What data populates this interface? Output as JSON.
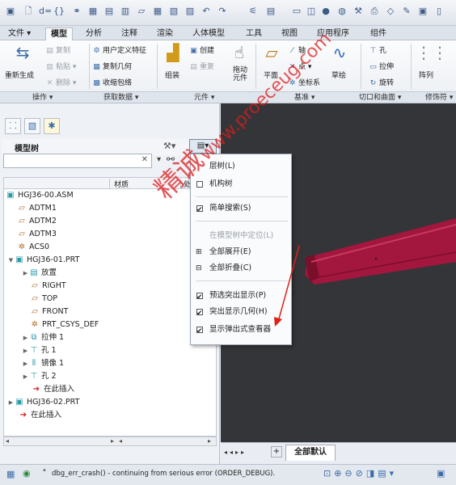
{
  "ribbon_tabs": [
    {
      "label": "文件 ▾",
      "active": false
    },
    {
      "label": "模型",
      "active": true
    },
    {
      "label": "分析",
      "active": false
    },
    {
      "label": "注释",
      "active": false
    },
    {
      "label": "渲染",
      "active": false
    },
    {
      "label": "人体模型",
      "active": false
    },
    {
      "label": "工具",
      "active": false
    },
    {
      "label": "视图",
      "active": false
    },
    {
      "label": "应用程序",
      "active": false
    },
    {
      "label": "组件",
      "active": false
    }
  ],
  "ribbon": {
    "regen": "重新生成",
    "copy": "复制",
    "paste": "粘贴 ▾",
    "delete": "删除 ▾",
    "user_feature": "用户定义特征",
    "copy_geometry": "复制几何",
    "shrinkwrap": "收缩包络",
    "assemble": "组装",
    "create": "创建",
    "reorder": "重复",
    "pull_elem": "拖动元件",
    "plane": "平面",
    "axis": "轴",
    "point": "点 ▾",
    "csys": "坐标系",
    "sketch": "草绘",
    "hole": "孔",
    "extrude": "拉伸",
    "revolve": "旋转",
    "pattern": "阵列"
  },
  "groups": {
    "operations": "操作 ▾",
    "get_data": "获取数据 ▾",
    "component": "元件 ▾",
    "datum": "基准 ▾",
    "cut_surface": "切口和曲面 ▾",
    "modifiers": "修饰符 ▾"
  },
  "tree": {
    "title": "模型树",
    "col_material": "材质",
    "col_other": "处",
    "rows": [
      {
        "label": "HGJ36-00.ASM",
        "icon": "assembly-icon"
      },
      {
        "label": "ADTM1",
        "icon": "datum-plane-icon"
      },
      {
        "label": "ADTM2",
        "icon": "datum-plane-icon"
      },
      {
        "label": "ADTM3",
        "icon": "datum-plane-icon"
      },
      {
        "label": "ACS0",
        "icon": "csys-icon"
      },
      {
        "label": "HGJ36-01.PRT",
        "icon": "part-icon"
      },
      {
        "label": "放置",
        "icon": "placement-icon"
      },
      {
        "label": "RIGHT",
        "icon": "datum-plane-icon"
      },
      {
        "label": "TOP",
        "icon": "datum-plane-icon"
      },
      {
        "label": "FRONT",
        "icon": "datum-plane-icon"
      },
      {
        "label": "PRT_CSYS_DEF",
        "icon": "csys-icon"
      },
      {
        "label": "拉伸 1",
        "icon": "extrude-icon"
      },
      {
        "label": "孔 1",
        "icon": "hole-icon"
      },
      {
        "label": "镜像 1",
        "icon": "mirror-icon"
      },
      {
        "label": "孔 2",
        "icon": "hole-icon"
      },
      {
        "label": "在此插入",
        "icon": "insert-arrow-icon"
      },
      {
        "label": "HGJ36-02.PRT",
        "icon": "part-icon"
      },
      {
        "label": "在此插入",
        "icon": "insert-arrow-icon"
      }
    ]
  },
  "menu": {
    "items": [
      {
        "label": "层树(L)",
        "check": "none",
        "enabled": true
      },
      {
        "label": "机构树",
        "check": "off",
        "enabled": true
      },
      {
        "label": "简单搜索(S)",
        "check": "on",
        "enabled": true
      },
      {
        "label": "在模型树中定位(L)",
        "check": "none",
        "enabled": false
      },
      {
        "label": "全部展开(E)",
        "check": "none",
        "enabled": true
      },
      {
        "label": "全部折叠(C)",
        "check": "none",
        "enabled": true
      },
      {
        "label": "预选突出显示(P)",
        "check": "on",
        "enabled": true
      },
      {
        "label": "突出显示几何(H)",
        "check": "on",
        "enabled": true
      },
      {
        "label": "显示弹出式查看器",
        "check": "on",
        "enabled": true
      }
    ]
  },
  "viewport_tab": "全部默认",
  "status_message": "dbg_err_crash() - continuing from serious error (ORDER_DEBUG).",
  "watermark": {
    "cn": "精诚",
    "url": "www.proeceug.com"
  },
  "colors": {
    "rod": "#a3163d",
    "viewport_bg": "#333538",
    "accent": "#2d6bb5"
  }
}
